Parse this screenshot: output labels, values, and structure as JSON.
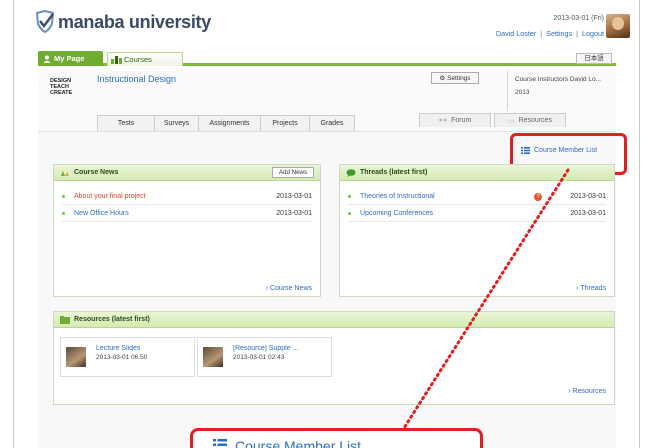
{
  "header": {
    "logo_text": "manaba university",
    "date": "2013-03-01 (Fri)",
    "user_name": "David Loster",
    "settings_link": "Settings",
    "logout_link": "Logout",
    "separator": "|"
  },
  "nav": {
    "mypage_label": "My Page",
    "courses_label": "Courses",
    "lang_label": "日本語"
  },
  "course": {
    "logo_lines": [
      "DESIGN",
      "TEACH",
      "CREATE"
    ],
    "title": "Instructional Design",
    "settings_btn": "Settings",
    "instructors": "Course Instructors  David Lo...",
    "year": "2013",
    "tabs": [
      "Tests",
      "Surveys",
      "Assignments",
      "Projects",
      "Grades"
    ],
    "forum_tab": "Forum",
    "resources_tab": "Resources"
  },
  "member_list_link": "Course Member List",
  "news": {
    "title": "Course News",
    "add_button": "Add News",
    "items": [
      {
        "title": "About your final project",
        "date": "2013-03-01"
      },
      {
        "title": "New Office Hours",
        "date": "2013-03-01"
      }
    ],
    "more_link": "Course News"
  },
  "threads": {
    "title": "Threads (latest first)",
    "items": [
      {
        "title": "Theories of Instructional",
        "date": "2013-03-01",
        "badge": "?"
      },
      {
        "title": "Upcoming Conferences",
        "date": "2013-03-01"
      }
    ],
    "more_link": "Threads"
  },
  "resources": {
    "title": "Resources (latest first)",
    "items": [
      {
        "name": "Lecture Slides",
        "date": "2013-03-01 06:50"
      },
      {
        "name": "[Resource] Supple ...",
        "date": "2013-03-01 02:43"
      }
    ],
    "more_link": "Resources"
  },
  "callout": {
    "text": "Course Member List"
  },
  "colors": {
    "accent_green": "#6fac2f",
    "link_blue": "#2e6bc4",
    "highlight_red": "#e02020"
  }
}
